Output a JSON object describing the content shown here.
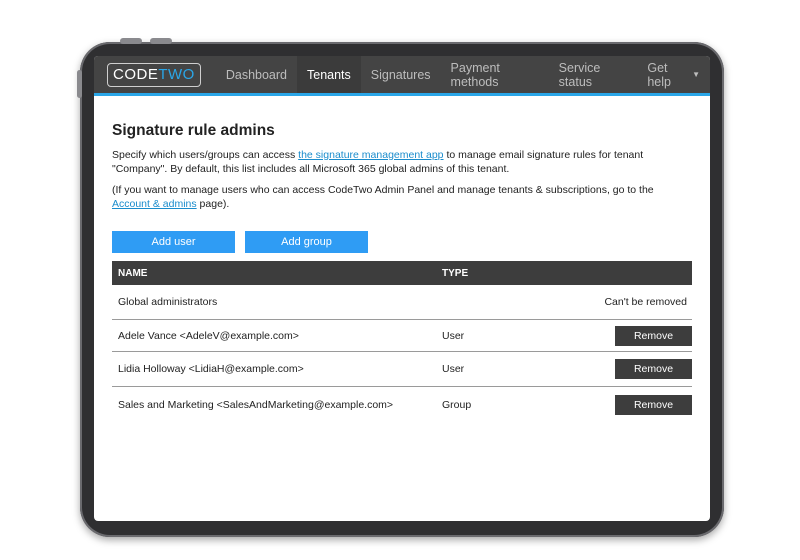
{
  "nav": {
    "logo": {
      "part1": "CODE",
      "part2": "TWO"
    },
    "items": [
      {
        "label": "Dashboard",
        "active": false
      },
      {
        "label": "Tenants",
        "active": true
      },
      {
        "label": "Signatures",
        "active": false
      },
      {
        "label": "Payment methods",
        "active": false
      },
      {
        "label": "Service status",
        "active": false
      },
      {
        "label": "Get help",
        "active": false,
        "dropdown": true
      }
    ],
    "caret_glyph": "▼"
  },
  "main": {
    "title": "Signature rule admins",
    "intro_part1": "Specify which users/groups can access ",
    "intro_link": "the signature management app",
    "intro_part2": " to manage email signature rules for tenant \"Company\". By default, this list includes all Microsoft 365 global admins of this tenant.",
    "note_part1": "(If you want to manage users who can access CodeTwo Admin Panel and manage tenants & subscriptions, go to the ",
    "note_link": "Account & admins",
    "note_part2": " page).",
    "buttons": {
      "add_user": "Add user",
      "add_group": "Add group"
    }
  },
  "table": {
    "headers": {
      "name": "NAME",
      "type": "TYPE"
    },
    "rows": [
      {
        "name": "Global administrators",
        "type": "",
        "action": "Can't be removed",
        "removable": false
      },
      {
        "name": "Adele Vance <AdeleV@example.com>",
        "type": "User",
        "action": "Remove",
        "removable": true
      },
      {
        "name": "Lidia Holloway <LidiaH@example.com>",
        "type": "User",
        "action": "Remove",
        "removable": true
      },
      {
        "name": "Sales and Marketing <SalesAndMarketing@example.com>",
        "type": "Group",
        "action": "Remove",
        "removable": true
      }
    ]
  },
  "colors": {
    "accent": "#2aa6e8",
    "button_primary": "#2f9cf4",
    "nav_bg": "#444444",
    "table_header_bg": "#3d3d3d"
  }
}
